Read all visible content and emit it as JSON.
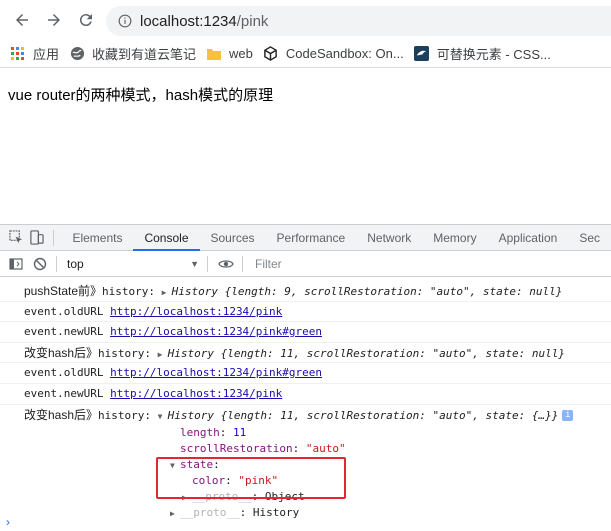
{
  "browser": {
    "url_host": "localhost:1234",
    "url_path": "/pink"
  },
  "bookmarks": [
    {
      "icon": "apps-grid-icon",
      "label": "应用"
    },
    {
      "icon": "globe-icon",
      "label": "收藏到有道云笔记"
    },
    {
      "icon": "folder-icon",
      "label": "web"
    },
    {
      "icon": "cube-icon",
      "label": "CodeSandbox: On..."
    },
    {
      "icon": "bird-icon",
      "label": "可替换元素 - CSS..."
    }
  ],
  "page": {
    "heading": "vue router的两种模式，hash模式的原理"
  },
  "devtools": {
    "tabs": [
      "Elements",
      "Console",
      "Sources",
      "Performance",
      "Network",
      "Memory",
      "Application",
      "Sec"
    ],
    "active_tab": "Console",
    "context": "top",
    "filter_placeholder": "Filter"
  },
  "console": {
    "line1": {
      "label": "pushState前》",
      "text": "history: ",
      "obj": "History {length: 9, scrollRestoration: \"auto\", state: null}"
    },
    "line2": {
      "label": "event.oldURL",
      "link": "http://localhost:1234/pink"
    },
    "line3": {
      "label": "event.newURL",
      "link": "http://localhost:1234/pink#green"
    },
    "line4": {
      "label": "改变hash后》",
      "text": "history: ",
      "obj": "History {length: 11, scrollRestoration: \"auto\", state: null}"
    },
    "line5": {
      "label": "event.oldURL",
      "link": "http://localhost:1234/pink#green"
    },
    "line6": {
      "label": "event.newURL",
      "link": "http://localhost:1234/pink"
    },
    "line7": {
      "label": "改变hash后》",
      "text": "history: ",
      "obj": "History {length: 11, scrollRestoration: \"auto\", state: {…}}"
    },
    "expanded": {
      "length_key": "length",
      "length_val": "11",
      "scroll_key": "scrollRestoration",
      "scroll_val": "\"auto\"",
      "state_key": "state",
      "color_key": "color",
      "color_val": "\"pink\"",
      "proto_key": "__proto__",
      "proto_val": "Object",
      "proto2_key": "__proto__",
      "proto2_val": "History"
    }
  },
  "colors": {
    "highlight_box": "#e0292a",
    "link": "#1a0dab",
    "accent": "#1a73e8"
  }
}
